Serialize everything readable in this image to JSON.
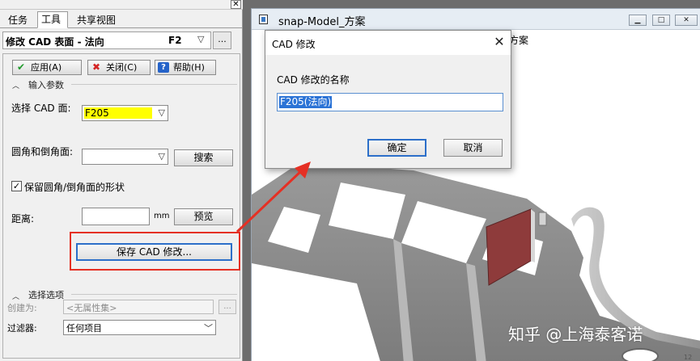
{
  "left_panel": {
    "tabs": [
      {
        "label": "任务",
        "active": false
      },
      {
        "label": "工具",
        "active": true
      },
      {
        "label": "共享视图",
        "active": false
      }
    ],
    "close_glyph": "✕",
    "title_field": {
      "text": "修改 CAD 表面 - 法向",
      "shortcut": "F2"
    },
    "more_label": "...",
    "buttons": {
      "apply": "应用(A)",
      "close": "关闭(C)",
      "help": "帮助(H)"
    },
    "input_params": {
      "header": "输入参数",
      "cad_face_label": "选择 CAD 面:",
      "cad_face_value": "F205",
      "fillet_label": "圆角和倒角面:",
      "fillet_value": "",
      "search_button": "搜索",
      "keep_shape_label": "保留圆角/倒角面的形状",
      "keep_shape_checked": true,
      "distance_label": "距离:",
      "distance_value": "",
      "distance_unit": "mm",
      "preview_button": "预览",
      "save_button": "保存 CAD 修改..."
    },
    "select_options": {
      "header": "选择选项",
      "create_as_label": "创建为:",
      "create_as_value": "<无属性集>",
      "create_more": "...",
      "filter_label": "过滤器:",
      "filter_value": "任何项目"
    }
  },
  "main_window": {
    "title": "snap-Model_方案",
    "hint_text": "方案",
    "min_glyph": "▁",
    "max_glyph": "□",
    "close_glyph": "✕"
  },
  "dialog": {
    "title": "CAD 修改",
    "close_glyph": "✕",
    "name_label": "CAD 修改的名称",
    "name_value": "F205(法向)",
    "ok_button": "确定",
    "cancel_button": "取消"
  },
  "watermark": "知乎 @上海泰客诺",
  "corner_text": "12",
  "colors": {
    "highlight_yellow": "#ffff00",
    "callout_red": "#e53024",
    "selection_blue": "#2b73d6",
    "model_gray": "#8a8a8a",
    "selected_face": "#8e3b3b"
  }
}
